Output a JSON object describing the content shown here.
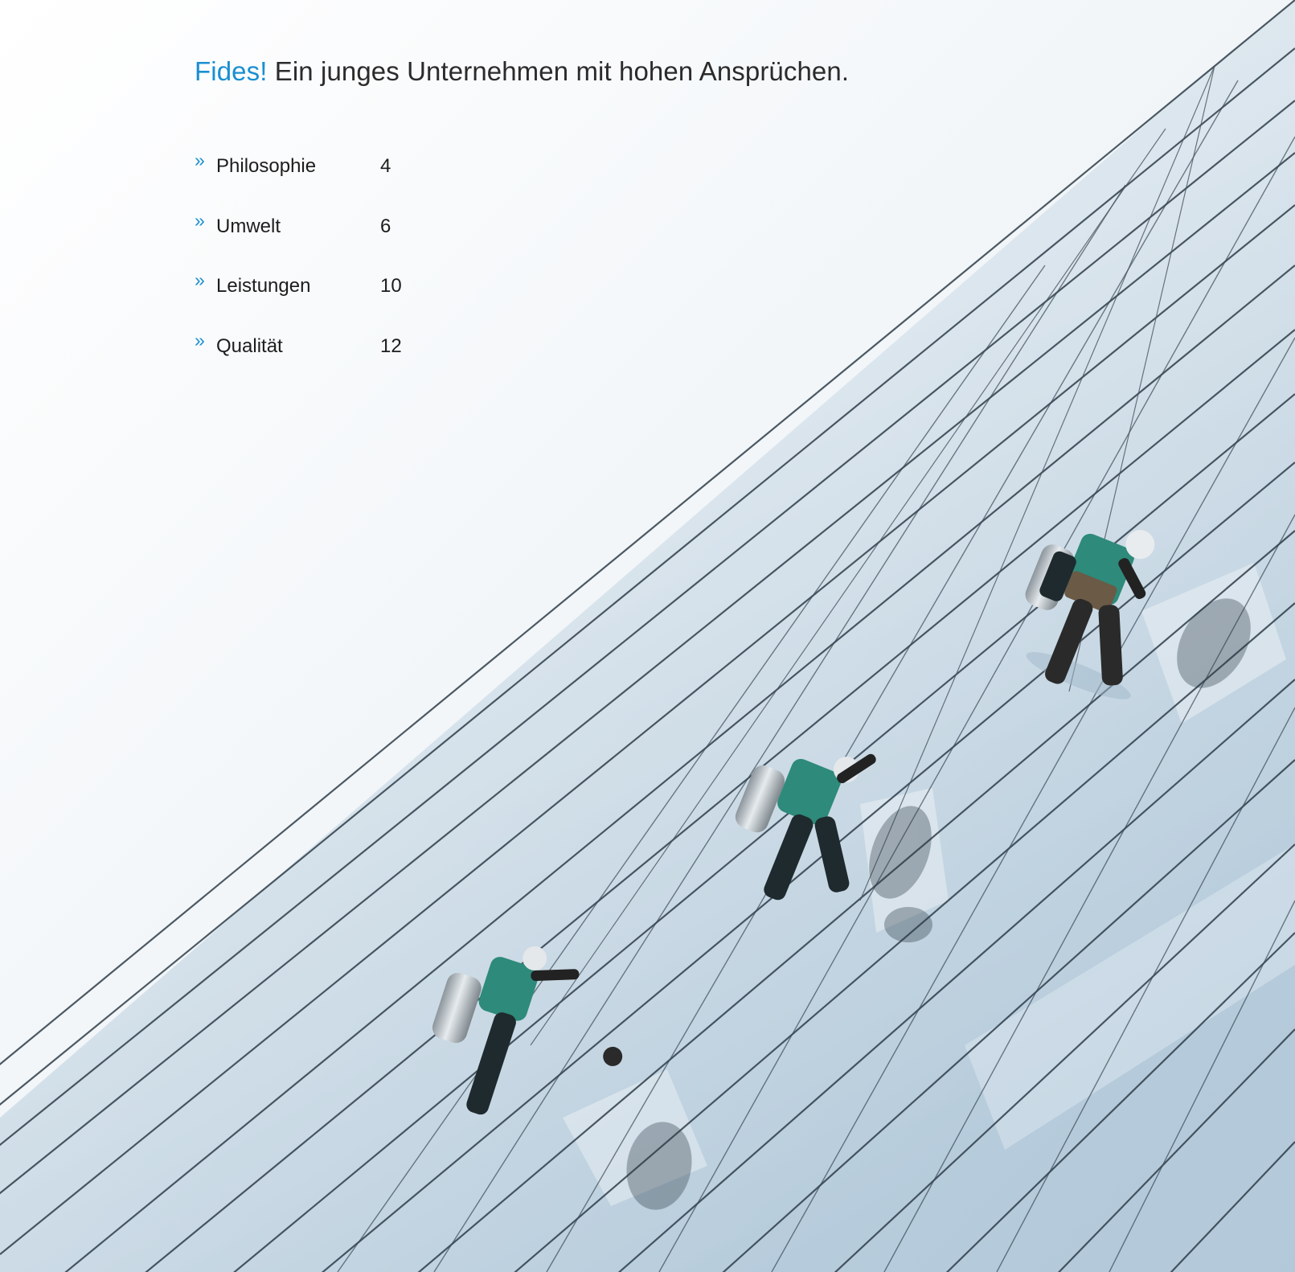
{
  "headline": {
    "brand": "Fides!",
    "text": "Ein junges Unternehmen mit hohen Ansprüchen."
  },
  "toc": {
    "arrow": "»",
    "items": [
      {
        "label": "Philosophie",
        "page": "4"
      },
      {
        "label": "Umwelt",
        "page": "6"
      },
      {
        "label": "Leistungen",
        "page": "10"
      },
      {
        "label": "Qualität",
        "page": "12"
      }
    ]
  },
  "colors": {
    "accent": "#1a8fd1",
    "text": "#1d1d1d",
    "sky": "#eef3f7",
    "glass": "#a9c3d6",
    "vest": "#2e8a7a"
  },
  "photo": {
    "subject": "window-cleaners-abseiling-on-glass-facade"
  }
}
